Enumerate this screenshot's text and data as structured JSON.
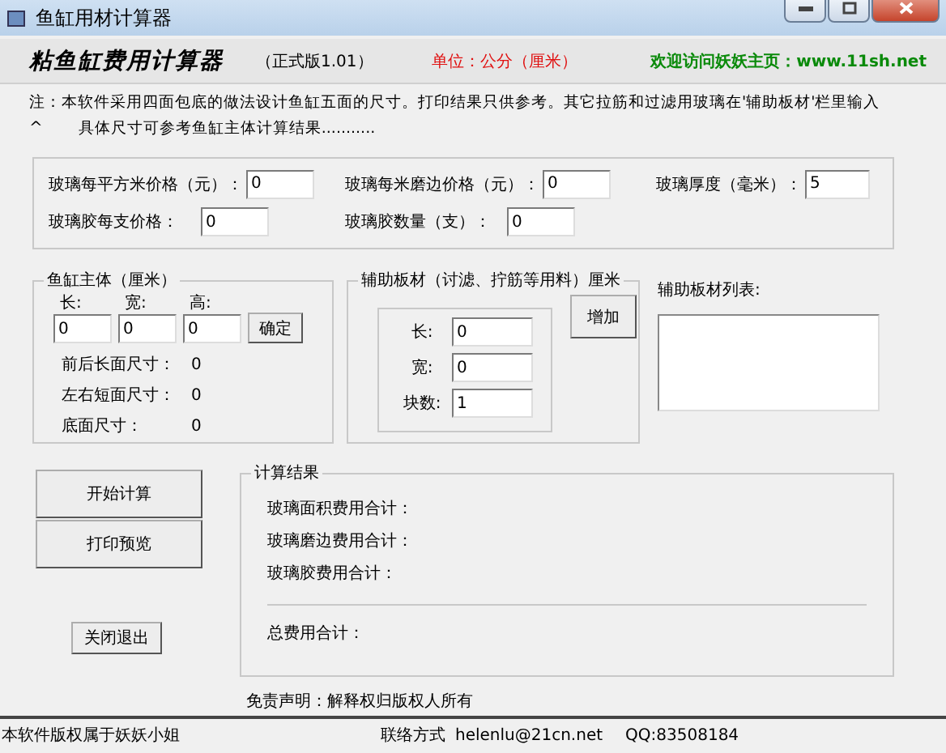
{
  "window": {
    "title": "鱼缸用材计算器"
  },
  "header": {
    "title": "粘鱼缸费用计算器",
    "version": "（正式版1.01）",
    "unit": "单位：公分（厘米）",
    "link": "欢迎访问妖妖主页：www.11sh.net"
  },
  "note": {
    "line1": "注：本软件采用四面包底的做法设计鱼缸五面的尺寸。打印结果只供参考。其它拉筋和过滤用玻璃在'辅助板材'栏里输入",
    "marker": "^",
    "line2": "具体尺寸可参考鱼缸主体计算结果..........."
  },
  "prices": [
    {
      "label": "玻璃每平方米价格（元）：",
      "value": "0"
    },
    {
      "label": "玻璃每米磨边价格（元）：",
      "value": "0"
    },
    {
      "label": "玻璃厚度（毫米）：",
      "value": "5"
    },
    {
      "label": "玻璃胶每支价格：",
      "value": "0"
    },
    {
      "label": "玻璃胶数量（支）：",
      "value": "0"
    }
  ],
  "body": {
    "title": "鱼缸主体（厘米）",
    "fields": [
      {
        "label": "长:",
        "value": "0"
      },
      {
        "label": "宽:",
        "value": "0"
      },
      {
        "label": "高:",
        "value": "0"
      }
    ],
    "button": "确定",
    "sizes": [
      {
        "label": "前后长面尺寸：",
        "value": "0"
      },
      {
        "label": "左右短面尺寸：",
        "value": "0"
      },
      {
        "label": "底面尺寸：",
        "value": "0"
      }
    ]
  },
  "aux": {
    "title": "辅助板材（讨滤、拧筋等用料）厘米",
    "fields": [
      {
        "label": "长:",
        "value": "0"
      },
      {
        "label": "宽:",
        "value": "0"
      },
      {
        "label": "块数:",
        "value": "1"
      }
    ],
    "button": "增加"
  },
  "aux_list": {
    "label": "辅助板材列表:"
  },
  "actions": [
    "开始计算",
    "打印预览"
  ],
  "close_button": "关闭退出",
  "results": {
    "title": "计算结果",
    "items": [
      "玻璃面积费用合计：",
      "玻璃磨边费用合计：",
      "玻璃胶费用合计："
    ],
    "total": "总费用合计："
  },
  "disclaimer": "免责声明：解释权归版权人所有",
  "status_bar": {
    "copyright": "本软件版权属于妖妖小姐",
    "contact": "联络方式",
    "email": "helenlu@21cn.net",
    "qq": "QQ:83508184"
  }
}
